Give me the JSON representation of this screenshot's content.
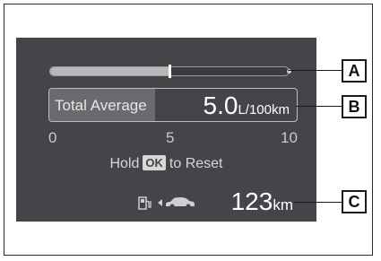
{
  "fuel_gauge": {
    "fill_fraction": 0.5
  },
  "average": {
    "label": "Total Average",
    "value": "5.0",
    "unit": "L/100km"
  },
  "scale_ticks": [
    "0",
    "5",
    "10"
  ],
  "reset_hint": {
    "prefix": "Hold",
    "key": "OK",
    "suffix": "to Reset"
  },
  "range": {
    "value": "123",
    "unit": "km",
    "icons": [
      "fuel-pump-icon",
      "small-arrow-icon",
      "car-icon"
    ]
  },
  "callouts": [
    "A",
    "B",
    "C"
  ],
  "colors": {
    "display_bg": "#444548",
    "label_bg": "#6a6b6e",
    "text": "#ffffff"
  }
}
